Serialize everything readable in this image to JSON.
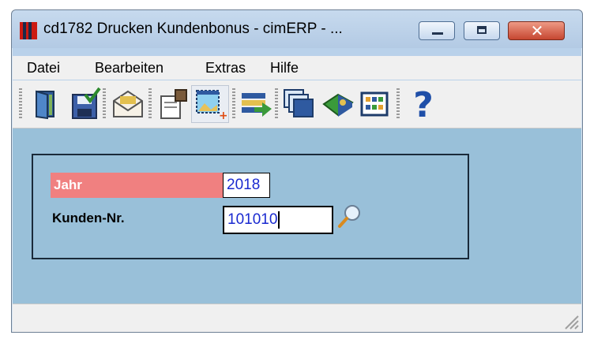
{
  "window": {
    "title": "cd1782 Drucken Kundenbonus - cimERP - ...",
    "close_glyph": "✕"
  },
  "menu": [
    "Datei",
    "Bearbeiten",
    "Extras",
    "Hilfe"
  ],
  "toolbar": {
    "icons": [
      "exit-door-icon",
      "save-icon",
      "email-icon",
      "print-preview-icon",
      "new-window-icon",
      "export-list-icon",
      "windows-icon",
      "book-icon",
      "calendar-grid-icon",
      "help-icon"
    ],
    "help_glyph": "?"
  },
  "form": {
    "jahr_label": "Jahr",
    "jahr_value": "2018",
    "kunde_label": "Kunden-Nr.",
    "kunde_value": "101010"
  },
  "colors": {
    "content_bg": "#99c0d9",
    "required_label_bg": "#f08080",
    "input_text": "#1a2ad0"
  }
}
